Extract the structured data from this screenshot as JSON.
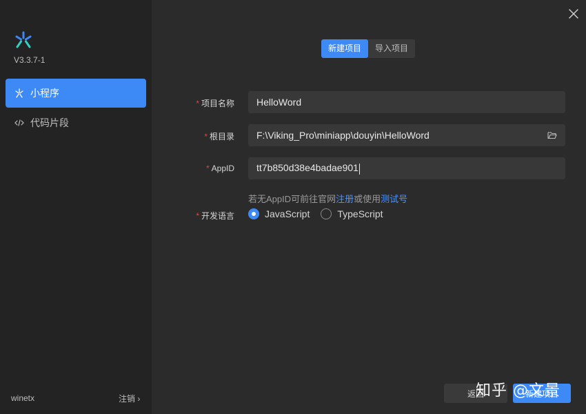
{
  "app": {
    "version": "V3.3.7-1",
    "accent_color": "#3d8af7",
    "logo_icon": "bytedance-devtools-logo"
  },
  "sidebar": {
    "items": [
      {
        "label": "小程序",
        "icon": "asterisk-icon",
        "active": true
      },
      {
        "label": "代码片段",
        "icon": "code-icon",
        "active": false
      }
    ],
    "user": "winetx",
    "logout_label": "注销 ›"
  },
  "tabs": [
    {
      "label": "新建项目",
      "active": true
    },
    {
      "label": "导入项目",
      "active": false
    }
  ],
  "form": {
    "required_mark": "*",
    "project_name": {
      "label": "项目名称",
      "value": "HelloWord"
    },
    "root_dir": {
      "label": "根目录",
      "value": "F:\\Viking_Pro\\miniapp\\douyin\\HelloWord"
    },
    "appid": {
      "label": "AppID",
      "value": "tt7b850d38e4badae901"
    },
    "hint": {
      "prefix": "若无AppID可前往官网",
      "register_link": "注册",
      "middle": "或使用",
      "test_link": "测试号"
    },
    "language": {
      "label": "开发语言",
      "options": [
        "JavaScript",
        "TypeScript"
      ],
      "selected": "JavaScript"
    }
  },
  "footer": {
    "back_label": "返回",
    "create_label": "新建项目"
  },
  "watermark": "知乎 @文景"
}
